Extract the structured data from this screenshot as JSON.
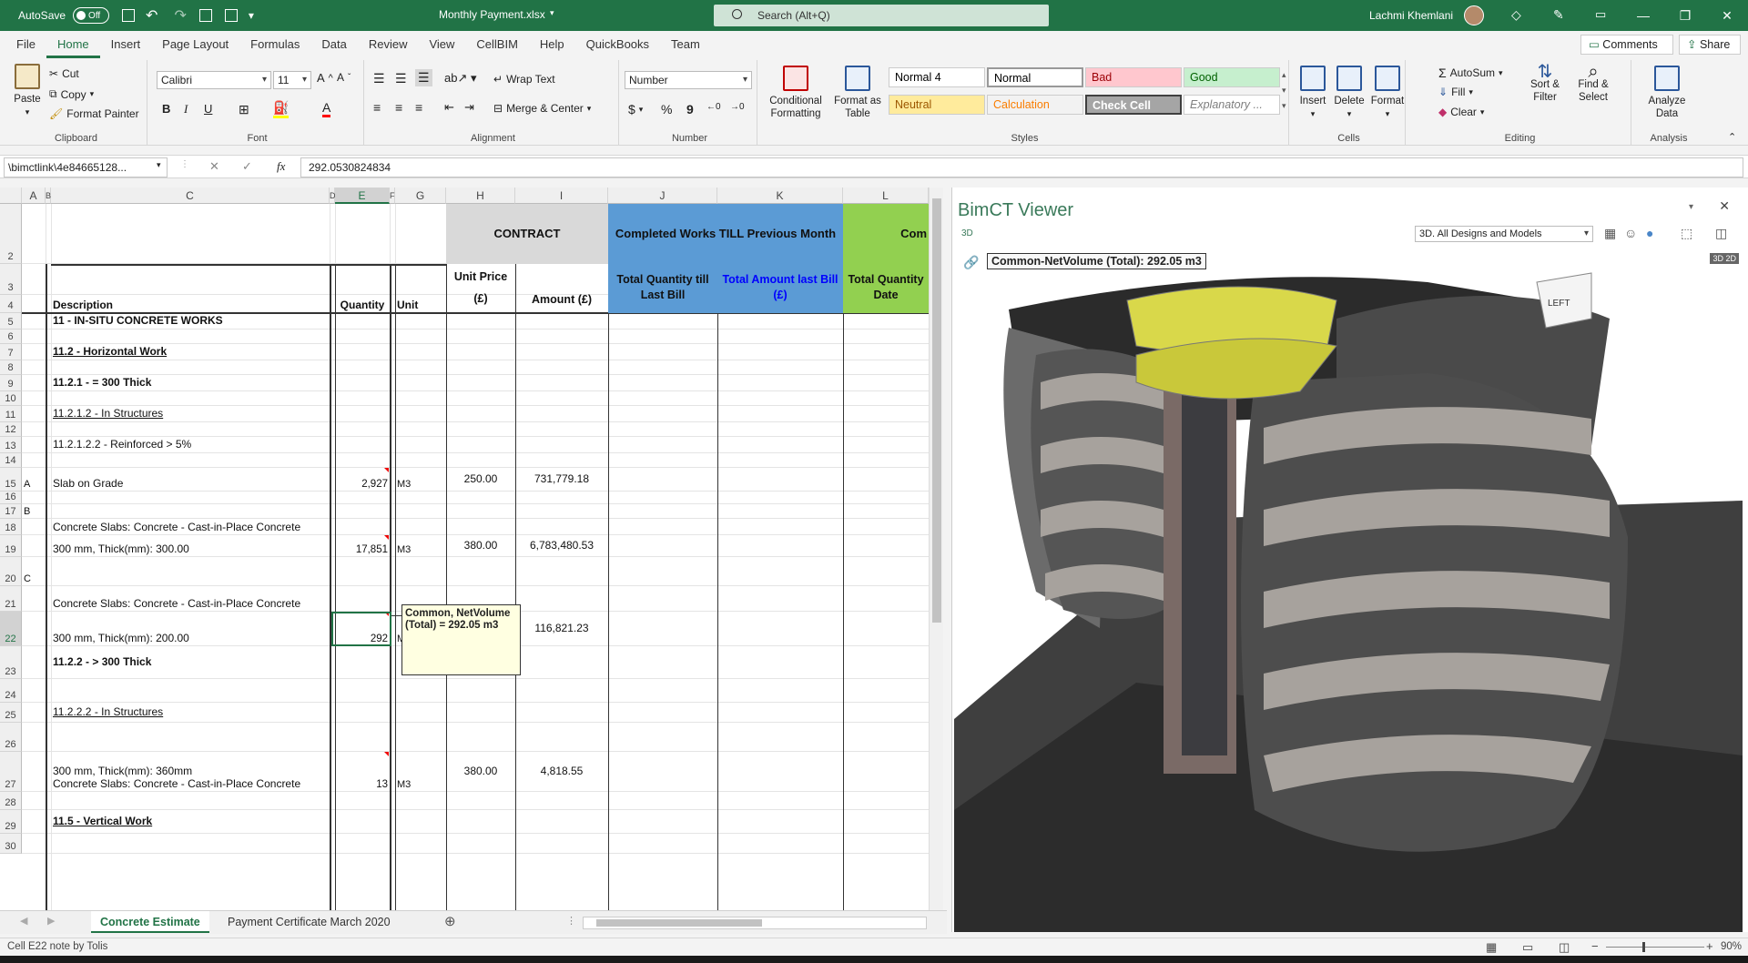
{
  "titlebar": {
    "autosave_label": "AutoSave",
    "autosave_state": "Off",
    "file_name": "Monthly Payment.xlsx",
    "search_placeholder": "Search (Alt+Q)",
    "user_name": "Lachmi Khemlani"
  },
  "menu": {
    "tabs": [
      "File",
      "Home",
      "Insert",
      "Page Layout",
      "Formulas",
      "Data",
      "Review",
      "View",
      "CellBIM",
      "Help",
      "QuickBooks",
      "Team"
    ],
    "active": "Home",
    "comments_label": "Comments",
    "share_label": "Share"
  },
  "ribbon": {
    "clipboard": {
      "paste": "Paste",
      "cut": "Cut",
      "copy": "Copy",
      "format_painter": "Format Painter",
      "label": "Clipboard"
    },
    "font": {
      "name": "Calibri",
      "size": "11",
      "label": "Font",
      "bold": "B",
      "italic": "I",
      "underline": "U"
    },
    "alignment": {
      "wrap_text": "Wrap Text",
      "merge_center": "Merge & Center",
      "label": "Alignment"
    },
    "number": {
      "format": "Number",
      "currency": "$",
      "percent": "%",
      "comma": "9",
      "label": "Number"
    },
    "styles": {
      "conditional": "Conditional Formatting",
      "format_table": "Format as Table",
      "cells": [
        {
          "name": "Normal 4",
          "bg": "#ffffff",
          "fg": "#000000"
        },
        {
          "name": "Normal",
          "bg": "#ffffff",
          "fg": "#000000"
        },
        {
          "name": "Bad",
          "bg": "#ffc7ce",
          "fg": "#9c0006"
        },
        {
          "name": "Good",
          "bg": "#c6efce",
          "fg": "#006100"
        },
        {
          "name": "Neutral",
          "bg": "#ffeb9c",
          "fg": "#9c5700"
        },
        {
          "name": "Calculation",
          "bg": "#f2f2f2",
          "fg": "#fa7d00"
        },
        {
          "name": "Check Cell",
          "bg": "#a5a5a5",
          "fg": "#ffffff"
        },
        {
          "name": "Explanatory ...",
          "bg": "#ffffff",
          "fg": "#7f7f7f"
        }
      ],
      "label": "Styles"
    },
    "cells": {
      "insert": "Insert",
      "delete": "Delete",
      "format": "Format",
      "label": "Cells"
    },
    "editing": {
      "autosum": "AutoSum",
      "fill": "Fill",
      "clear": "Clear",
      "sort_filter": "Sort & Filter",
      "find_select": "Find & Select",
      "label": "Editing"
    },
    "analysis": {
      "analyze_data": "Analyze Data",
      "label": "Analysis"
    }
  },
  "formula_bar": {
    "name_box": "\\bimctlink\\4e84665128...",
    "fx": "fx",
    "value": "292.0530824834"
  },
  "columns": [
    "A",
    "B",
    "C",
    "D",
    "E",
    "F",
    "G",
    "H",
    "I",
    "J",
    "K",
    "L"
  ],
  "header": {
    "contract": "CONTRACT",
    "completed": "Completed Works TILL Previous Month",
    "current": "Com",
    "description": "Description",
    "quantity": "Quantity",
    "unit": "Unit",
    "unit_price": "Unit Price (£)",
    "amount": "Amount (£)",
    "total_qty_last": "Total Quantity till Last Bill",
    "total_amt_last": "Total Amount last Bill (£)",
    "total_qty_date": "Total Quantity Date"
  },
  "rows": [
    {
      "num": "2",
      "a": "",
      "c": "",
      "e": "",
      "g": "",
      "h": "",
      "i": ""
    },
    {
      "num": "3",
      "a": "",
      "c": "",
      "e": "",
      "g": "",
      "h": "",
      "i": ""
    },
    {
      "num": "4",
      "a": "",
      "c": "",
      "e": "",
      "g": "",
      "h": "",
      "i": ""
    },
    {
      "num": "5",
      "a": "",
      "c": "11 - IN-SITU CONCRETE WORKS",
      "e": "",
      "g": "",
      "h": "",
      "i": ""
    },
    {
      "num": "6",
      "a": "",
      "c": "",
      "e": "",
      "g": "",
      "h": "",
      "i": ""
    },
    {
      "num": "7",
      "a": "",
      "c": "11.2 - Horizontal Work",
      "e": "",
      "g": "",
      "h": "",
      "i": ""
    },
    {
      "num": "8",
      "a": "",
      "c": "",
      "e": "",
      "g": "",
      "h": "",
      "i": ""
    },
    {
      "num": "9",
      "a": "",
      "c": "11.2.1 - = 300 Thick",
      "e": "",
      "g": "",
      "h": "",
      "i": ""
    },
    {
      "num": "10",
      "a": "",
      "c": "",
      "e": "",
      "g": "",
      "h": "",
      "i": ""
    },
    {
      "num": "11",
      "a": "",
      "c": "11.2.1.2 - In Structures",
      "e": "",
      "g": "",
      "h": "",
      "i": ""
    },
    {
      "num": "12",
      "a": "",
      "c": "",
      "e": "",
      "g": "",
      "h": "",
      "i": ""
    },
    {
      "num": "13",
      "a": "",
      "c": "11.2.1.2.2 - Reinforced > 5%",
      "e": "",
      "g": "",
      "h": "",
      "i": ""
    },
    {
      "num": "14",
      "a": "",
      "c": "",
      "e": "",
      "g": "",
      "h": "",
      "i": ""
    },
    {
      "num": "15",
      "a": "A",
      "c": "Slab on Grade",
      "e": "2,927",
      "g": "M3",
      "h": "250.00",
      "i": "731,779.18"
    },
    {
      "num": "16",
      "a": "",
      "c": "",
      "e": "",
      "g": "",
      "h": "",
      "i": ""
    },
    {
      "num": "17",
      "a": "B",
      "c": "",
      "e": "",
      "g": "",
      "h": "",
      "i": ""
    },
    {
      "num": "18",
      "a": "",
      "c": "Concrete Slabs: Concrete - Cast-in-Place Concrete",
      "e": "",
      "g": "",
      "h": "",
      "i": ""
    },
    {
      "num": "19",
      "a": "",
      "c": "300 mm, Thick(mm): 300.00",
      "e": "17,851",
      "g": "M3",
      "h": "380.00",
      "i": "6,783,480.53"
    },
    {
      "num": "20",
      "a": "C",
      "c": "",
      "e": "",
      "g": "",
      "h": "",
      "i": ""
    },
    {
      "num": "21",
      "a": "",
      "c": "Concrete Slabs: Concrete - Cast-in-Place Concrete",
      "e": "",
      "g": "",
      "h": "",
      "i": ""
    },
    {
      "num": "22",
      "a": "",
      "c": "300 mm, Thick(mm): 200.00",
      "e": "292",
      "g": "M",
      "h": "",
      "i": "116,821.23"
    },
    {
      "num": "23",
      "a": "",
      "c": "11.2.2 - > 300 Thick",
      "e": "",
      "g": "",
      "h": "",
      "i": ""
    },
    {
      "num": "24",
      "a": "",
      "c": "",
      "e": "",
      "g": "",
      "h": "",
      "i": ""
    },
    {
      "num": "25",
      "a": "",
      "c": "11.2.2.2 - In Structures",
      "e": "",
      "g": "",
      "h": "",
      "i": ""
    },
    {
      "num": "26",
      "a": "",
      "c": "",
      "e": "",
      "g": "",
      "h": "",
      "i": ""
    },
    {
      "num": "27",
      "a": "",
      "c": "Concrete Slabs: Concrete - Cast-in-Place Concrete",
      "e": "13",
      "g": "M3",
      "h": "380.00",
      "i": "4,818.55"
    },
    {
      "num": "28",
      "a": "",
      "c": "",
      "e": "",
      "g": "",
      "h": "",
      "i": ""
    },
    {
      "num": "29",
      "a": "",
      "c": "11.5 - Vertical Work",
      "e": "",
      "g": "",
      "h": "",
      "i": ""
    },
    {
      "num": "30",
      "a": "",
      "c": "",
      "e": "",
      "g": "",
      "h": "",
      "i": ""
    }
  ],
  "row27_line2": "300 mm, Thick(mm): 360mm",
  "comment": "Common, NetVolume (Total) = 292.05 m3",
  "sheet_tabs": [
    "Concrete Estimate",
    "Payment Certificate March 2020"
  ],
  "status": {
    "left": "Cell E22 note by Tolis",
    "zoom": "90%"
  },
  "viewer": {
    "title": "BimCT Viewer",
    "mode": "3D",
    "dropdown": "3D. All Designs and Models",
    "toggle": "3D 2D",
    "tag": "Common-NetVolume (Total): 292.05 m3",
    "cube_label": "LEFT"
  }
}
